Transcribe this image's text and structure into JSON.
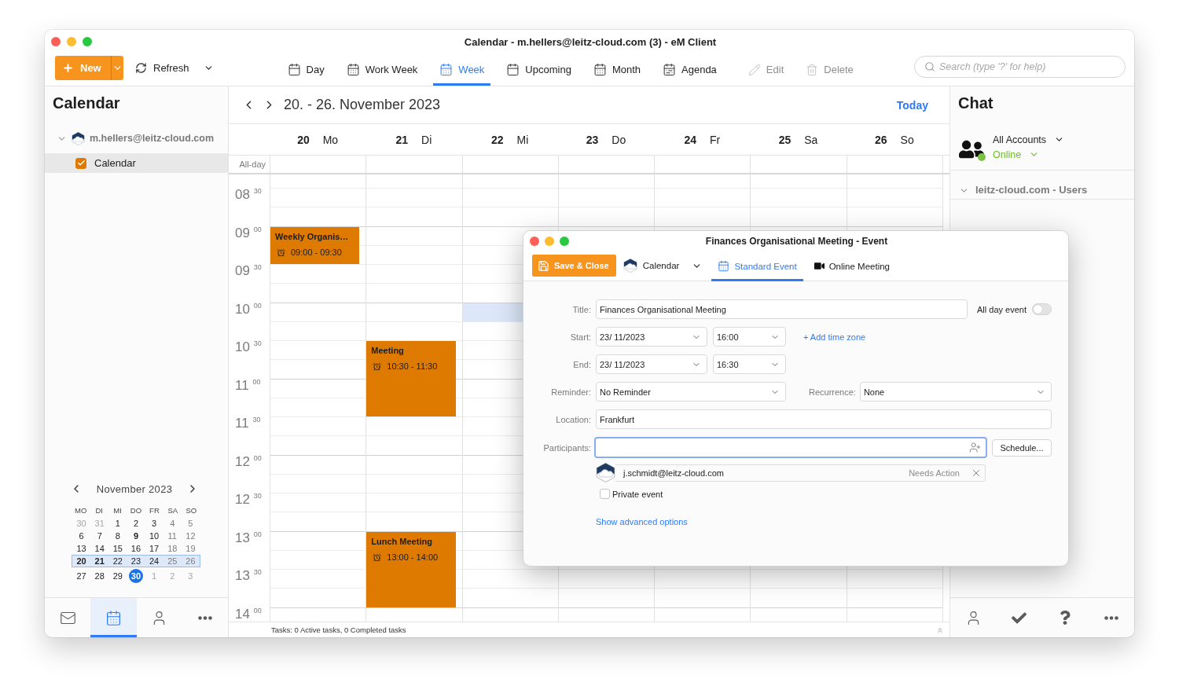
{
  "window": {
    "title": "Calendar - m.hellers@leitz-cloud.com (3) - eM Client"
  },
  "toolbar": {
    "new_button": "New",
    "refresh_button": "Refresh",
    "views": [
      {
        "label": "Day",
        "kind": "day",
        "selected": false
      },
      {
        "label": "Work Week",
        "kind": "work_week",
        "selected": false
      },
      {
        "label": "Week",
        "kind": "week",
        "selected": true
      },
      {
        "label": "Upcoming",
        "kind": "upcoming",
        "selected": false
      },
      {
        "label": "Month",
        "kind": "month",
        "selected": false
      },
      {
        "label": "Agenda",
        "kind": "agenda",
        "selected": false
      }
    ],
    "actions": [
      {
        "label": "Edit",
        "kind": "edit",
        "disabled": true
      },
      {
        "label": "Delete",
        "kind": "delete",
        "disabled": true
      }
    ],
    "search": {
      "placeholder": "Search (type '?' for help)"
    }
  },
  "sidebar": {
    "title": "Calendar",
    "accounts": [
      {
        "name": "m.hellers@leitz-cloud.com",
        "expanded": true,
        "children": [
          {
            "name": "Calendar",
            "checked": true,
            "selected": true
          }
        ]
      }
    ],
    "mini_calendar": {
      "month": "November 2023",
      "weekdays": [
        "MO",
        "DI",
        "MI",
        "DO",
        "FR",
        "SA",
        "SO"
      ],
      "weeks": [
        {
          "selected": false,
          "days": [
            {
              "day": "30",
              "in_month": false,
              "has_events": false,
              "today": false
            },
            {
              "day": "31",
              "in_month": false,
              "has_events": false,
              "today": false
            },
            {
              "day": "1",
              "in_month": true,
              "has_events": false,
              "today": false
            },
            {
              "day": "2",
              "in_month": true,
              "has_events": false,
              "today": false
            },
            {
              "day": "3",
              "in_month": true,
              "has_events": false,
              "today": false
            },
            {
              "day": "4",
              "in_month": true,
              "has_events": false,
              "today": false
            },
            {
              "day": "5",
              "in_month": true,
              "has_events": false,
              "today": false
            }
          ]
        },
        {
          "selected": false,
          "days": [
            {
              "day": "6",
              "in_month": true,
              "has_events": false,
              "today": false
            },
            {
              "day": "7",
              "in_month": true,
              "has_events": false,
              "today": false
            },
            {
              "day": "8",
              "in_month": true,
              "has_events": false,
              "today": false
            },
            {
              "day": "9",
              "in_month": true,
              "has_events": true,
              "today": false
            },
            {
              "day": "10",
              "in_month": true,
              "has_events": false,
              "today": false
            },
            {
              "day": "11",
              "in_month": true,
              "has_events": false,
              "today": false
            },
            {
              "day": "12",
              "in_month": true,
              "has_events": false,
              "today": false
            }
          ]
        },
        {
          "selected": false,
          "days": [
            {
              "day": "13",
              "in_month": true,
              "has_events": false,
              "today": false
            },
            {
              "day": "14",
              "in_month": true,
              "has_events": false,
              "today": false
            },
            {
              "day": "15",
              "in_month": true,
              "has_events": false,
              "today": false
            },
            {
              "day": "16",
              "in_month": true,
              "has_events": false,
              "today": false
            },
            {
              "day": "17",
              "in_month": true,
              "has_events": false,
              "today": false
            },
            {
              "day": "18",
              "in_month": true,
              "has_events": false,
              "today": false
            },
            {
              "day": "19",
              "in_month": true,
              "has_events": false,
              "today": false
            }
          ]
        },
        {
          "selected": true,
          "days": [
            {
              "day": "20",
              "in_month": true,
              "has_events": true,
              "today": false
            },
            {
              "day": "21",
              "in_month": true,
              "has_events": true,
              "today": false
            },
            {
              "day": "22",
              "in_month": true,
              "has_events": false,
              "today": false
            },
            {
              "day": "23",
              "in_month": true,
              "has_events": false,
              "today": false
            },
            {
              "day": "24",
              "in_month": true,
              "has_events": false,
              "today": false
            },
            {
              "day": "25",
              "in_month": true,
              "has_events": false,
              "today": false
            },
            {
              "day": "26",
              "in_month": true,
              "has_events": false,
              "today": false
            }
          ]
        },
        {
          "selected": false,
          "days": [
            {
              "day": "27",
              "in_month": true,
              "has_events": false,
              "today": false
            },
            {
              "day": "28",
              "in_month": true,
              "has_events": false,
              "today": false
            },
            {
              "day": "29",
              "in_month": true,
              "has_events": false,
              "today": false
            },
            {
              "day": "30",
              "in_month": true,
              "has_events": false,
              "today": true
            },
            {
              "day": "1",
              "in_month": false,
              "has_events": false,
              "today": false
            },
            {
              "day": "2",
              "in_month": false,
              "has_events": false,
              "today": false
            },
            {
              "day": "3",
              "in_month": false,
              "has_events": false,
              "today": false
            }
          ]
        }
      ]
    },
    "nav": [
      {
        "kind": "mail",
        "selected": false
      },
      {
        "kind": "calendar",
        "selected": true
      },
      {
        "kind": "contacts",
        "selected": false
      },
      {
        "kind": "more",
        "selected": false
      }
    ]
  },
  "calendar": {
    "range_title": "20. - 26. November 2023",
    "today_button": "Today",
    "all_day_label": "All-day",
    "days": [
      {
        "date": "20",
        "weekday": "Mo",
        "events": [
          {
            "title": "Weekly Organis…",
            "time": "09:00 - 09:30"
          }
        ]
      },
      {
        "date": "21",
        "weekday": "Di",
        "events": [
          {
            "title": "Meeting",
            "time": "10:30 - 11:30"
          },
          {
            "title": "Lunch Meeting",
            "time": "13:00 - 14:00"
          }
        ]
      },
      {
        "date": "22",
        "weekday": "Mi"
      },
      {
        "date": "23",
        "weekday": "Do"
      },
      {
        "date": "24",
        "weekday": "Fr"
      },
      {
        "date": "25",
        "weekday": "Sa"
      },
      {
        "date": "26",
        "weekday": "So"
      }
    ],
    "time_labels": [
      "08 $^{30}$",
      "09 $^{00}$",
      "09 $^{30}$",
      "10 $^{00}$",
      "10 $^{30}$",
      "11 $^{00}$",
      "11 $^{30}$",
      "12 $^{00}$",
      "12 $^{30}$",
      "13 $^{00}$",
      "13 $^{30}$",
      "14 $^{00}$"
    ],
    "slot_selected": true,
    "status_bar": "Tasks: 0 Active tasks, 0 Completed tasks"
  },
  "chat": {
    "title": "Chat",
    "account_picker": "All Accounts",
    "status_picker": "Online",
    "groups": [
      {
        "name": "leitz-cloud.com - Users",
        "expanded": true
      }
    ],
    "nav": [
      {
        "kind": "contacts"
      },
      {
        "kind": "tasks"
      },
      {
        "kind": "help"
      },
      {
        "kind": "more"
      }
    ]
  },
  "event_dialog": {
    "title": "Finances Organisational Meeting - Event",
    "save_button": "Save & Close",
    "calendar_picker": "Calendar",
    "tabs": [
      {
        "label": "Standard Event",
        "kind": "standard",
        "selected": true
      },
      {
        "label": "Online Meeting",
        "kind": "online",
        "selected": false
      }
    ],
    "title_field": {
      "label": "Title:",
      "value": "Finances Organisational Meeting"
    },
    "all_day": {
      "label": "All day event",
      "on": false
    },
    "start": {
      "label": "Start:",
      "date": "23/ 11/2023",
      "time": "16:00"
    },
    "add_time_zone_link": "+ Add time zone",
    "end": {
      "label": "End:",
      "date": "23/ 11/2023",
      "time": "16:30"
    },
    "reminder": {
      "label": "Reminder:",
      "value": "No Reminder"
    },
    "recurrence": {
      "label": "Recurrence:",
      "value": "None"
    },
    "location": {
      "label": "Location:",
      "value": "Frankfurt"
    },
    "participants": {
      "label": "Participants:",
      "focused": true,
      "schedule_button": "Schedule...",
      "list": [
        {
          "email": "j.schmidt@leitz-cloud.com",
          "status": "Needs Action"
        }
      ]
    },
    "private_event": {
      "label": "Private event",
      "checked": false
    },
    "advanced_link": "Show advanced options"
  }
}
